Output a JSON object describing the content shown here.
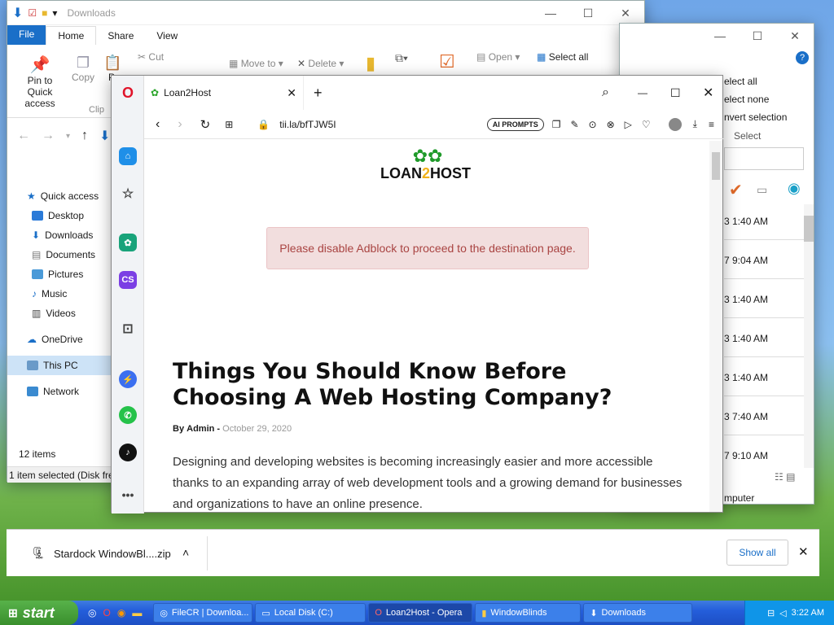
{
  "explorer": {
    "title": "Downloads",
    "tabs": [
      "File",
      "Home",
      "Share",
      "View"
    ],
    "ribbon": {
      "pin": "Pin to Quick access",
      "copy": "Copy",
      "paste": "P",
      "cut": "Cut",
      "move_to": "Move to",
      "delete": "Delete",
      "open": "Open",
      "select_all": "Select all",
      "clipboard": "Clip"
    },
    "nav": [
      "Quick access",
      "Desktop",
      "Downloads",
      "Documents",
      "Pictures",
      "Music",
      "Videos",
      "OneDrive",
      "This PC",
      "Network"
    ],
    "status_items": "12 items",
    "status_selected": "1 item selected (Disk fre"
  },
  "explorer2": {
    "select_all": "elect all",
    "select_none": "elect none",
    "invert": "nvert selection",
    "select_group": "Select",
    "times": [
      "3 1:40 AM",
      "7 9:04 AM",
      "3 1:40 AM",
      "3 1:40 AM",
      "3 1:40 AM",
      "3 7:40 AM",
      "7 9:10 AM"
    ],
    "status": "mputer"
  },
  "opera": {
    "tab_title": "Loan2Host",
    "url": "tii.la/bfTJW5I",
    "ai_prompts": "AI PROMPTS",
    "sidebar_cs": "CS",
    "logo_left": "LOAN",
    "logo_right": "HOST",
    "alert": "Please disable Adblock to proceed to the destination page.",
    "article": {
      "title": "Things You Should Know Before Choosing A Web Hosting Company?",
      "by": "By",
      "author": "Admin",
      "date": "October 29, 2020",
      "body": "Designing and developing websites is becoming increasingly easier and more accessible thanks to an expanding array of web development tools and a growing demand for businesses and organizations to have an online presence."
    }
  },
  "download_bar": {
    "file": "Stardock WindowBl....zip",
    "show_all": "Show all"
  },
  "taskbar": {
    "start": "start",
    "items": [
      "FileCR | Downloa...",
      "Local Disk (C:)",
      "Loan2Host - Opera",
      "WindowBlinds",
      "Downloads"
    ],
    "clock": "3:22 AM"
  }
}
